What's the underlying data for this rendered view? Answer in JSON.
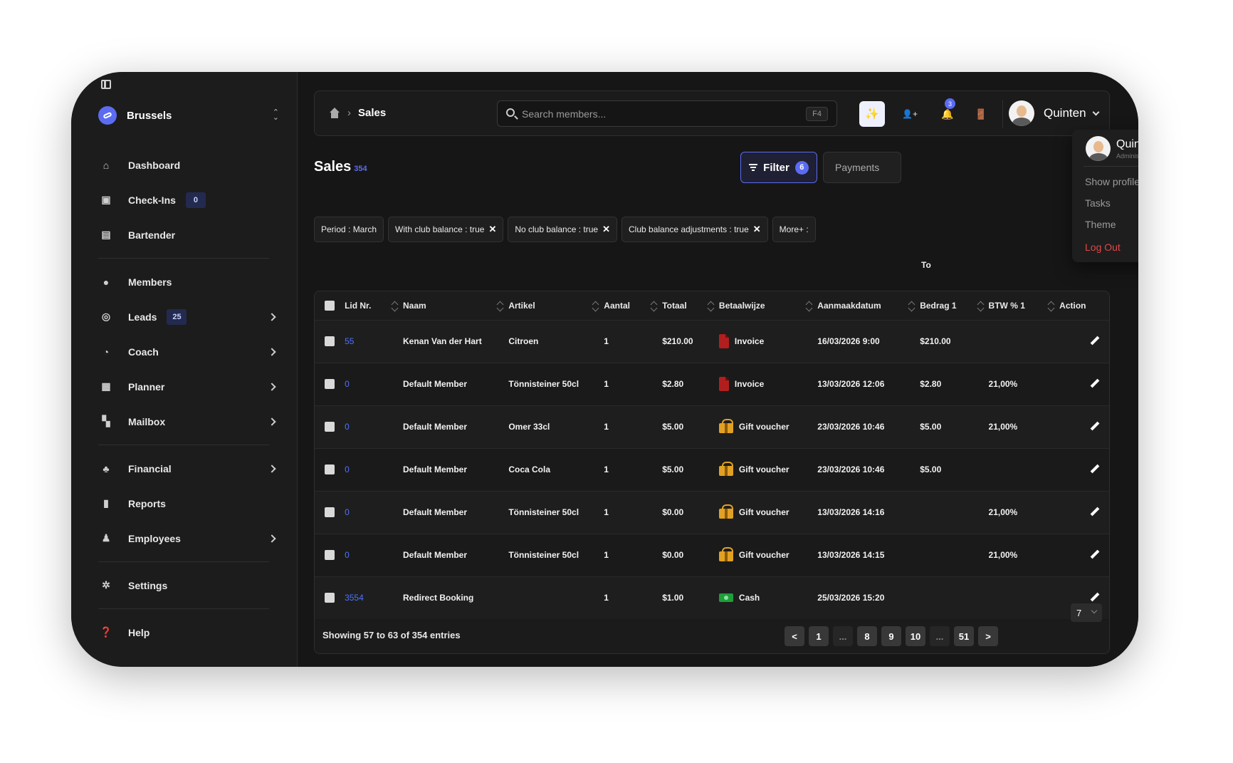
{
  "workspace": {
    "name": "Brussels"
  },
  "sidebar": {
    "items": [
      {
        "label": "Dashboard",
        "icon": "home-icon"
      },
      {
        "label": "Check-Ins",
        "icon": "checkin-icon",
        "badge": "0"
      },
      {
        "label": "Bartender",
        "icon": "bartender-icon"
      },
      {
        "label": "Members",
        "icon": "members-icon"
      },
      {
        "label": "Leads",
        "icon": "leads-icon",
        "badge": "25"
      },
      {
        "label": "Coach",
        "icon": "coach-icon"
      },
      {
        "label": "Planner",
        "icon": "planner-icon"
      },
      {
        "label": "Mailbox",
        "icon": "mailbox-icon"
      },
      {
        "label": "Financial",
        "icon": "financial-icon"
      },
      {
        "label": "Reports",
        "icon": "reports-icon"
      },
      {
        "label": "Employees",
        "icon": "employees-icon"
      },
      {
        "label": "Settings",
        "icon": "gear-icon"
      },
      {
        "label": "Help",
        "icon": "help-icon"
      }
    ]
  },
  "header": {
    "breadcrumb": "Sales",
    "search_placeholder": "Search members...",
    "search_shortcut": "F4",
    "notifications_count": "3",
    "user_name": "Quinten",
    "icons": {
      "magic": "✨",
      "add_user": "👤+",
      "bell": "🔔",
      "door": "🚪"
    }
  },
  "page": {
    "title": "Sales",
    "count": "354",
    "filter_label": "Filter",
    "filter_count": "6",
    "payments_label": "Payments",
    "to_label": "To"
  },
  "chips": [
    {
      "label": "Period : March",
      "removable": false
    },
    {
      "label": "With club balance : true",
      "removable": true
    },
    {
      "label": "No club balance : true",
      "removable": true
    },
    {
      "label": "Club balance adjustments : true",
      "removable": true
    },
    {
      "label": "More+ :",
      "removable": false
    }
  ],
  "table": {
    "columns": [
      "Lid Nr.",
      "Naam",
      "Artikel",
      "Aantal",
      "Totaal",
      "Betaalwijze",
      "Aanmaakdatum",
      "Bedrag 1",
      "BTW % 1",
      "Action"
    ],
    "rows": [
      {
        "lid": "55",
        "naam": "Kenan Van der Hart",
        "artikel": "Citroen",
        "aantal": "1",
        "totaal": "$210.00",
        "betaalwijze": "Invoice",
        "pay_type": "invoice",
        "datum": "16/03/2026 9:00",
        "bedrag": "$210.00",
        "btw": ""
      },
      {
        "lid": "0",
        "naam": "Default Member",
        "artikel": "Tönnisteiner 50cl",
        "aantal": "1",
        "totaal": "$2.80",
        "betaalwijze": "Invoice",
        "pay_type": "invoice",
        "datum": "13/03/2026 12:06",
        "bedrag": "$2.80",
        "btw": "21,00%"
      },
      {
        "lid": "0",
        "naam": "Default Member",
        "artikel": "Omer 33cl",
        "aantal": "1",
        "totaal": "$5.00",
        "betaalwijze": "Gift voucher",
        "pay_type": "gift",
        "datum": "23/03/2026 10:46",
        "bedrag": "$5.00",
        "btw": "21,00%"
      },
      {
        "lid": "0",
        "naam": "Default Member",
        "artikel": "Coca Cola",
        "aantal": "1",
        "totaal": "$5.00",
        "betaalwijze": "Gift voucher",
        "pay_type": "gift",
        "datum": "23/03/2026 10:46",
        "bedrag": "$5.00",
        "btw": ""
      },
      {
        "lid": "0",
        "naam": "Default Member",
        "artikel": "Tönnisteiner 50cl",
        "aantal": "1",
        "totaal": "$0.00",
        "betaalwijze": "Gift voucher",
        "pay_type": "gift",
        "datum": "13/03/2026 14:16",
        "bedrag": "",
        "btw": "21,00%"
      },
      {
        "lid": "0",
        "naam": "Default Member",
        "artikel": "Tönnisteiner 50cl",
        "aantal": "1",
        "totaal": "$0.00",
        "betaalwijze": "Gift voucher",
        "pay_type": "gift",
        "datum": "13/03/2026 14:15",
        "bedrag": "",
        "btw": "21,00%"
      },
      {
        "lid": "3554",
        "naam": "Redirect Booking",
        "artikel": "",
        "aantal": "1",
        "totaal": "$1.00",
        "betaalwijze": "Cash",
        "pay_type": "cash",
        "datum": "25/03/2026 15:20",
        "bedrag": "",
        "btw": ""
      }
    ]
  },
  "footer": {
    "showing": "Showing 57 to 63 of 354 entries",
    "pages": [
      "<",
      "1",
      "...",
      "8",
      "9",
      "10",
      "...",
      "51",
      ">"
    ],
    "per_page": "7"
  },
  "user_menu": {
    "name": "Quinten Van De Moere",
    "role": "Administrator",
    "items": [
      "Show profile",
      "Tasks",
      "Theme"
    ],
    "logout": "Log Out",
    "theme_icons": [
      "☀",
      "☾",
      "⏻"
    ]
  },
  "colors": {
    "accent": "#5b6cf2",
    "link": "#4d73ff",
    "danger": "#e04848"
  }
}
